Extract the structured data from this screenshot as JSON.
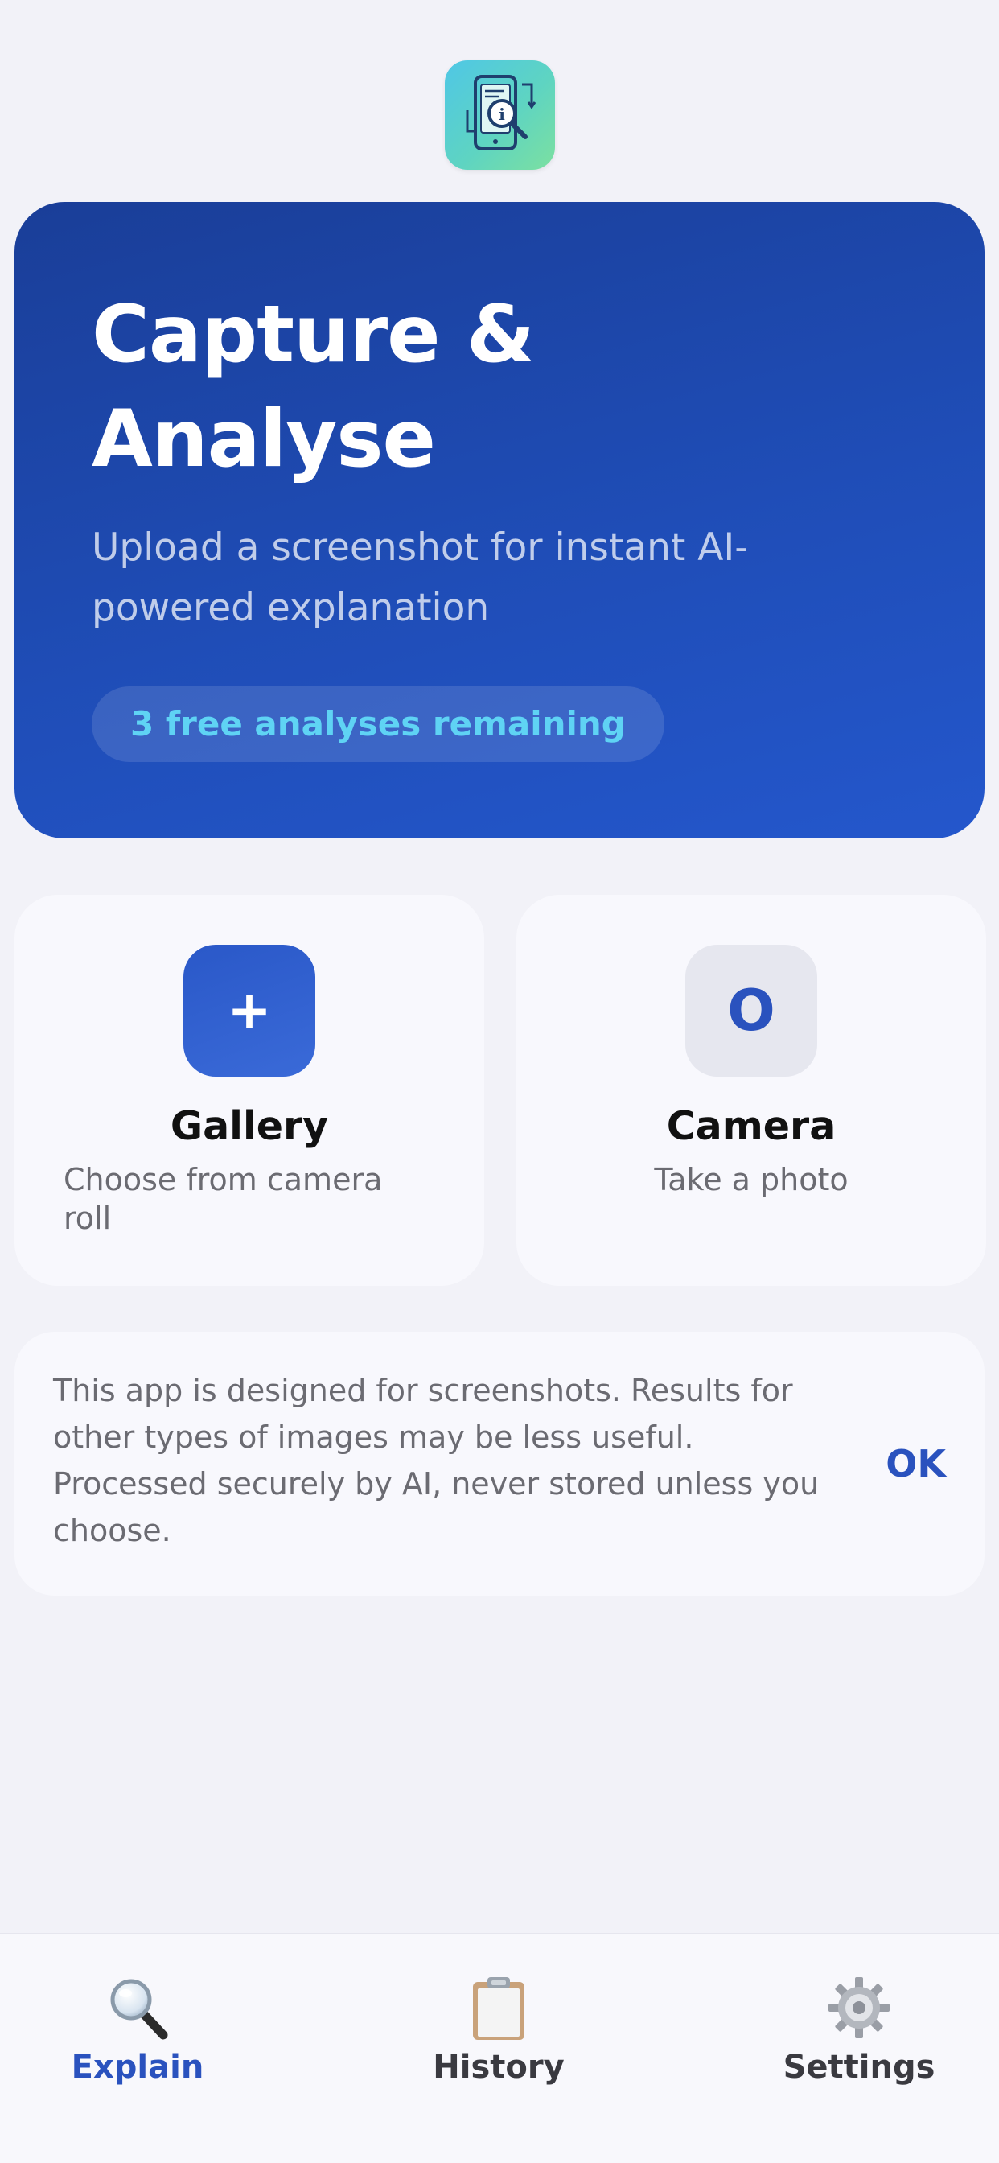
{
  "hero": {
    "title": "Capture & Analyse",
    "subtitle": "Upload a screenshot for instant AI-powered explanation",
    "badge": "3 free analyses remaining"
  },
  "actions": {
    "gallery": {
      "icon_glyph": "+",
      "icon": "plus-icon",
      "title": "Gallery",
      "subtitle": "Choose from camera roll"
    },
    "camera": {
      "icon_glyph": "O",
      "icon": "camera-icon",
      "title": "Camera",
      "subtitle": "Take a photo"
    }
  },
  "notice": {
    "text": "This app is designed for screenshots. Results for other types of images may be less useful. Processed securely by AI, never stored unless you choose.",
    "ok_label": "OK"
  },
  "tabs": [
    {
      "label": "Explain",
      "icon": "magnifier-icon",
      "active": true
    },
    {
      "label": "History",
      "icon": "clipboard-icon",
      "active": false
    },
    {
      "label": "Settings",
      "icon": "gear-icon",
      "active": false
    }
  ],
  "colors": {
    "accent": "#2a52be",
    "hero_gradient_start": "#1a3e98",
    "hero_gradient_end": "#2457cc",
    "badge_text": "#5fd3f4",
    "background": "#f2f2f8"
  }
}
